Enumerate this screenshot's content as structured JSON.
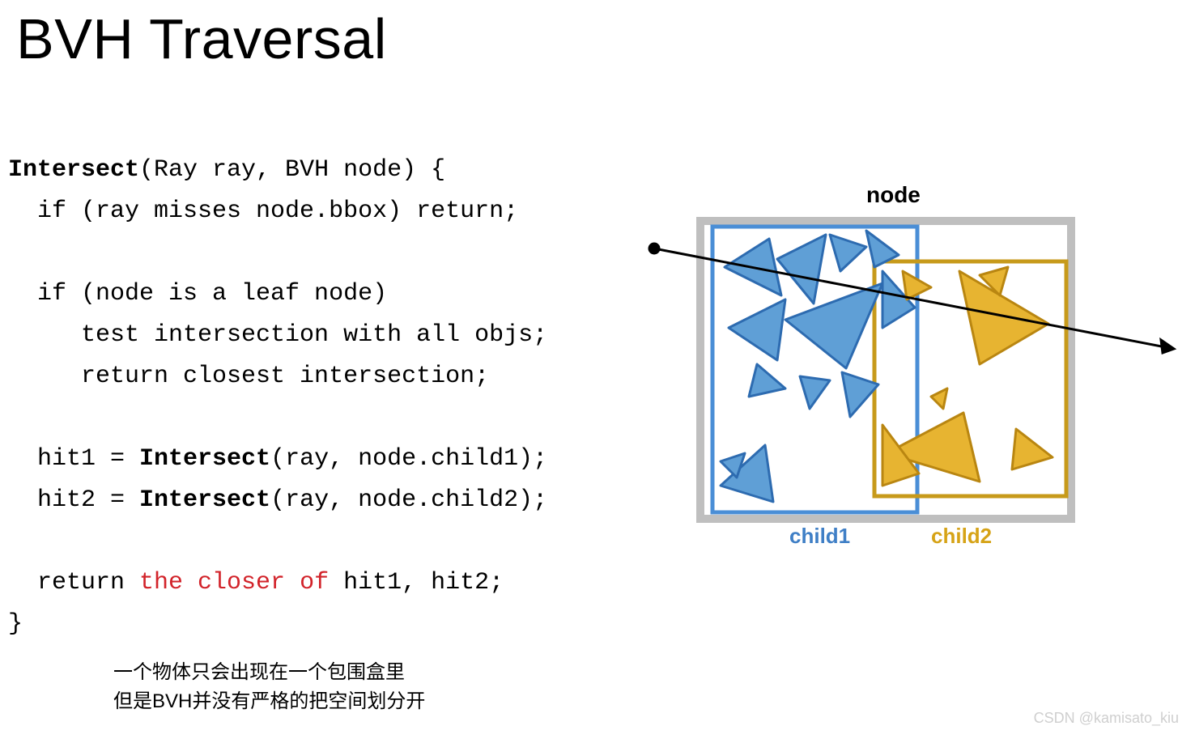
{
  "title": "BVH Traversal",
  "code": {
    "fn_name": "Intersect",
    "sig_open": "(Ray ray, BVH node) {",
    "l1": "  if (ray misses node.bbox) return;",
    "blank": "",
    "l2": "  if (node is a leaf node)",
    "l3": "     test intersection with all objs;",
    "l4": "     return closest intersection;",
    "l5a": "  hit1 = ",
    "l5b": "Intersect",
    "l5c": "(ray, node.child1);",
    "l6a": "  hit2 = ",
    "l6b": "Intersect",
    "l6c": "(ray, node.child2);",
    "l7a": "  return ",
    "l7b": "the closer of",
    "l7c": " hit1, hit2;",
    "close": "}"
  },
  "notes": {
    "n1": "一个物体只会出现在一个包围盒里",
    "n2": "但是BVH并没有严格的把空间划分开"
  },
  "diagram": {
    "node_label": "node",
    "child1_label": "child1",
    "child2_label": "child2",
    "colors": {
      "node_stroke": "#bfbfbf",
      "child1_stroke": "#4a8ed6",
      "child1_fill": "#5f9fd6",
      "child2_stroke": "#c79a1a",
      "child2_fill": "#e7b431"
    }
  },
  "watermark": "CSDN @kamisato_kiu"
}
